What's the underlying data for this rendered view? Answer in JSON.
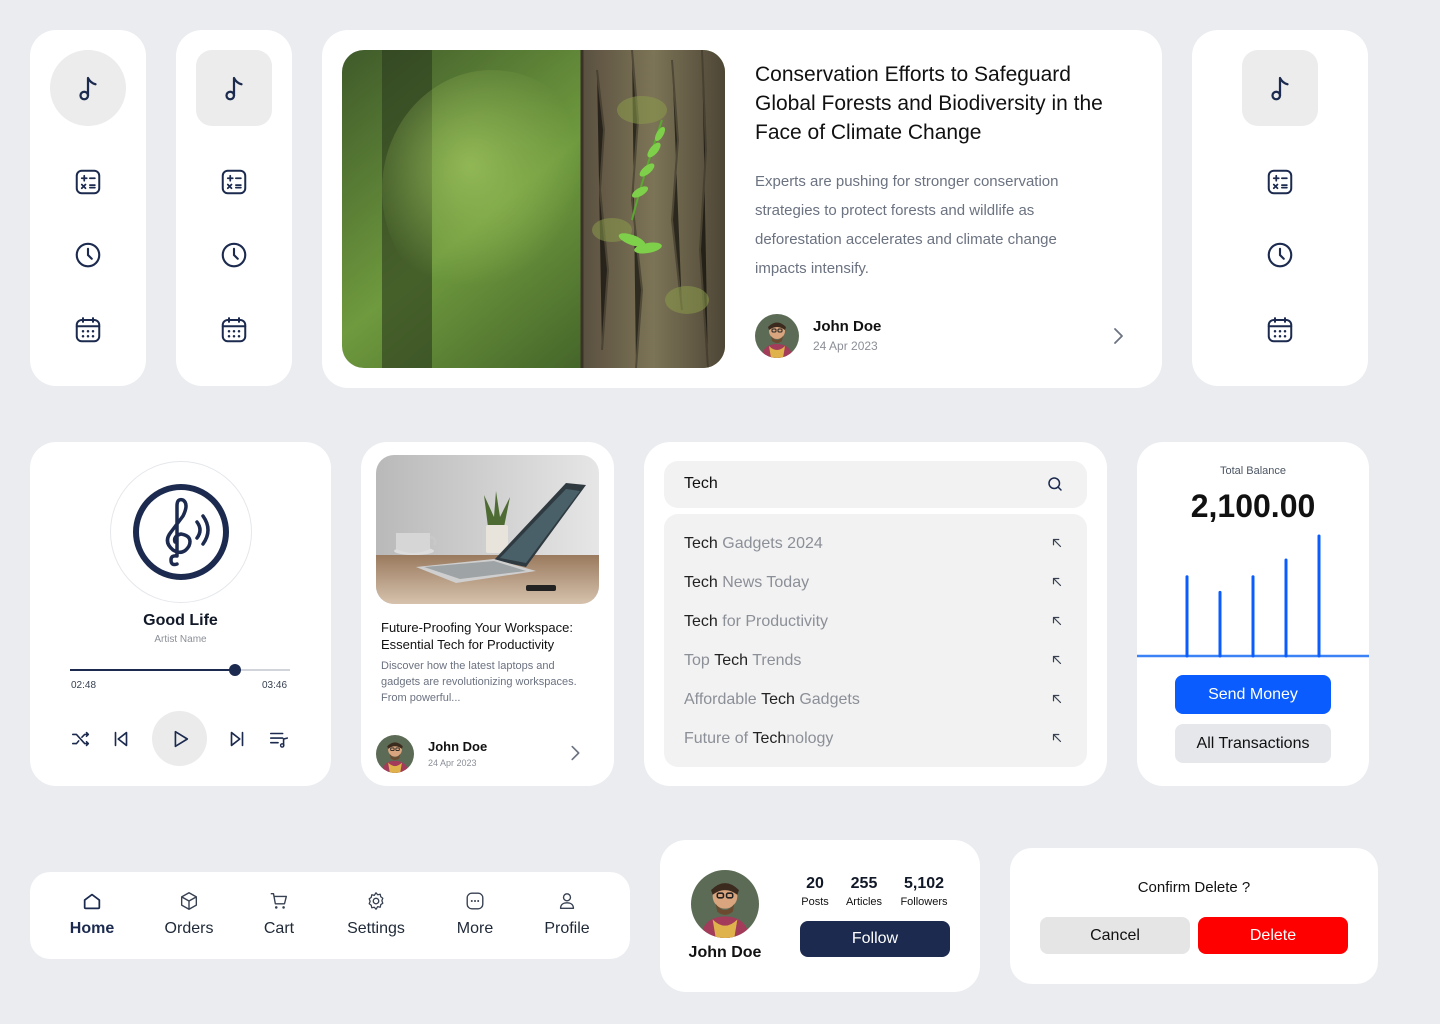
{
  "article_large": {
    "title": "Conservation Efforts to Safeguard Global Forests and Biodiversity in the Face of Climate Change",
    "description": "Experts are pushing for stronger conservation strategies to protect forests and wildlife as deforestation accelerates and climate change impacts intensify.",
    "author": "John Doe",
    "date": "24 Apr 2023"
  },
  "player": {
    "title": "Good Life",
    "artist": "Artist Name",
    "elapsed": "02:48",
    "duration": "03:46",
    "progress": 0.75
  },
  "article_small": {
    "title": "Future-Proofing Your Workspace: Essential Tech for Productivity",
    "description": "Discover how the latest laptops and gadgets are revolutionizing workspaces. From powerful...",
    "author": "John Doe",
    "date": "24 Apr 2023"
  },
  "search": {
    "query": "Tech",
    "suggestions": [
      {
        "bold": "Tech",
        "light": " Gadgets 2024",
        "order": "bold-first"
      },
      {
        "bold": "Tech",
        "light": " News Today",
        "order": "bold-first"
      },
      {
        "bold": "Tech",
        "light": " for Productivity",
        "order": "bold-first"
      },
      {
        "pre": "Top ",
        "bold": "Tech",
        "light": " Trends"
      },
      {
        "pre": "Affordable ",
        "bold": "Tech",
        "light": " Gadgets"
      },
      {
        "pre": "Future of ",
        "bold": "Tech",
        "light": "nology"
      }
    ]
  },
  "balance": {
    "label": "Total Balance",
    "amount": "2,100.00",
    "bars": [
      0.66,
      0.53,
      0.66,
      0.8,
      1.0
    ],
    "send_label": "Send Money",
    "transactions_label": "All Transactions",
    "accent": "#0b5cff"
  },
  "nav": {
    "items": [
      {
        "label": "Home",
        "icon": "home-icon",
        "active": true
      },
      {
        "label": "Orders",
        "icon": "box-icon"
      },
      {
        "label": "Cart",
        "icon": "cart-icon"
      },
      {
        "label": "Settings",
        "icon": "gear-icon"
      },
      {
        "label": "More",
        "icon": "more-icon"
      },
      {
        "label": "Profile",
        "icon": "user-icon"
      }
    ]
  },
  "profile": {
    "name": "John Doe",
    "stats": [
      {
        "value": "20",
        "label": "Posts"
      },
      {
        "value": "255",
        "label": "Articles"
      },
      {
        "value": "5,102",
        "label": "Followers"
      }
    ],
    "follow_label": "Follow",
    "navy": "#1b2a4e"
  },
  "confirm": {
    "title": "Confirm Delete ?",
    "cancel_label": "Cancel",
    "delete_label": "Delete",
    "danger": "#ff0000"
  }
}
